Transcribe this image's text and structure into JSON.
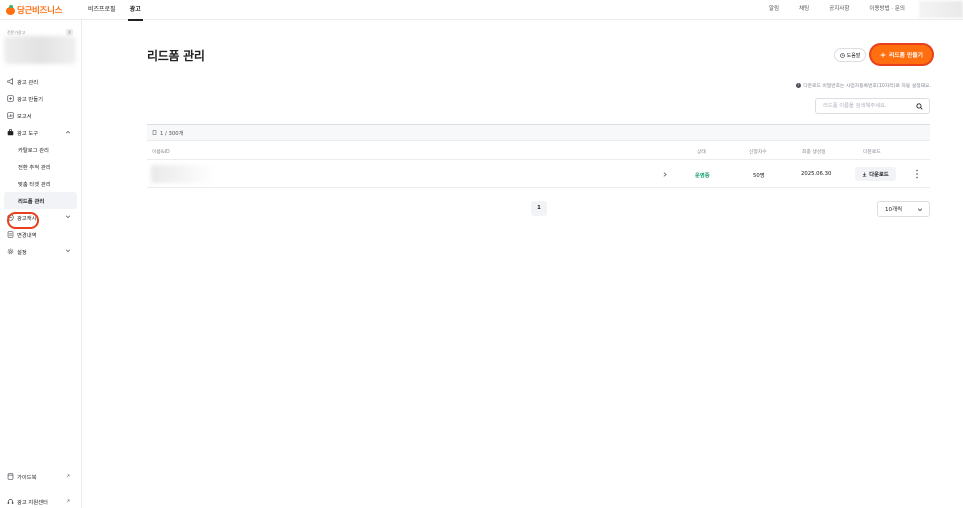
{
  "brand": {
    "name": "당근비즈니스",
    "color": "#ff6f0f"
  },
  "topnav": {
    "items": [
      "비즈프로필",
      "광고"
    ],
    "active": "광고"
  },
  "topright": {
    "items": [
      "알림",
      "채팅",
      "공지사항",
      "이용방법 · 문의"
    ]
  },
  "sidebar": {
    "account_label": "전문가광고",
    "account_close": "X",
    "menu": [
      {
        "label": "광고 관리",
        "icon": "megaphone-icon"
      },
      {
        "label": "광고 만들기",
        "icon": "plus-square-icon"
      },
      {
        "label": "보고서",
        "icon": "report-icon"
      },
      {
        "label": "광고 도구",
        "icon": "briefcase-icon",
        "expanded": true
      }
    ],
    "submenu": [
      "카탈로그 관리",
      "전환 추적 관리",
      "맞춤 타겟 관리",
      "리드폼 관리"
    ],
    "selected": "리드폼 관리",
    "menu2": [
      {
        "label": "광고캐시",
        "icon": "cash-icon"
      },
      {
        "label": "변경내역",
        "icon": "history-icon"
      },
      {
        "label": "설정",
        "icon": "gear-icon"
      }
    ],
    "bottom": [
      "가이드북",
      "광고 지원센터"
    ]
  },
  "main": {
    "title": "리드폼 관리",
    "help_label": "도움말",
    "create_label": "리드폼 만들기",
    "notice": "다운로드 비밀번호는 사업자등록번호(10자리)로 자동 설정돼요.",
    "search_placeholder": "리드폼 이름을 검색해주세요.",
    "count_label": "1 / 300개",
    "columns": [
      "이름&ID",
      "상태",
      "신청자수",
      "최종 생성일",
      "다운로드"
    ],
    "rows": [
      {
        "status": "운영중",
        "applicants": "50명",
        "date": "2025.06.30",
        "download_label": "다운로드"
      }
    ],
    "page": "1",
    "page_size": "10개씩"
  },
  "colors": {
    "accent": "#ff6f0f",
    "status_active": "#1aa174",
    "highlight_ring": "#e8401c"
  }
}
